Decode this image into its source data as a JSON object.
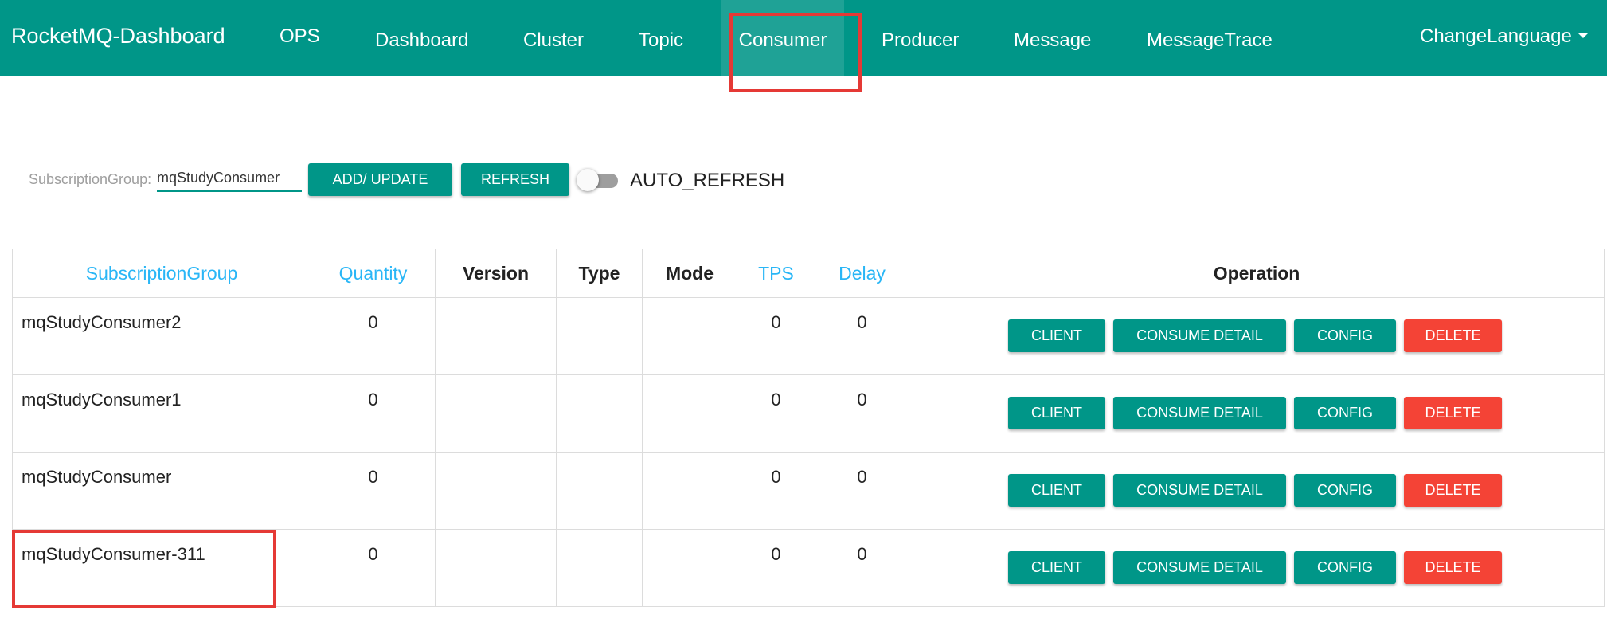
{
  "navbar": {
    "brand": "RocketMQ-Dashboard",
    "items": [
      {
        "label": "OPS"
      },
      {
        "label": "Dashboard"
      },
      {
        "label": "Cluster"
      },
      {
        "label": "Topic"
      },
      {
        "label": "Consumer"
      },
      {
        "label": "Producer"
      },
      {
        "label": "Message"
      },
      {
        "label": "MessageTrace"
      }
    ],
    "active": "Consumer",
    "language": "ChangeLanguage"
  },
  "toolbar": {
    "search_label": "SubscriptionGroup:",
    "search_value": "mqStudyConsumer",
    "add_update_label": "ADD/ UPDATE",
    "refresh_label": "REFRESH",
    "auto_refresh_label": "AUTO_REFRESH",
    "auto_refresh_on": false
  },
  "table": {
    "columns": [
      "SubscriptionGroup",
      "Quantity",
      "Version",
      "Type",
      "Mode",
      "TPS",
      "Delay",
      "Operation"
    ],
    "rows": [
      {
        "group": "mqStudyConsumer2",
        "quantity": "0",
        "version": "",
        "type": "",
        "mode": "",
        "tps": "0",
        "delay": "0"
      },
      {
        "group": "mqStudyConsumer1",
        "quantity": "0",
        "version": "",
        "type": "",
        "mode": "",
        "tps": "0",
        "delay": "0"
      },
      {
        "group": "mqStudyConsumer",
        "quantity": "0",
        "version": "",
        "type": "",
        "mode": "",
        "tps": "0",
        "delay": "0"
      },
      {
        "group": "mqStudyConsumer-311",
        "quantity": "0",
        "version": "",
        "type": "",
        "mode": "",
        "tps": "0",
        "delay": "0"
      }
    ],
    "actions": {
      "client": "CLIENT",
      "consume_detail": "CONSUME DETAIL",
      "config": "CONFIG",
      "delete": "DELETE"
    }
  },
  "colors": {
    "primary": "#009688",
    "danger": "#f44336",
    "sortable_header": "#29b6f6",
    "highlight_box": "#e53935"
  }
}
